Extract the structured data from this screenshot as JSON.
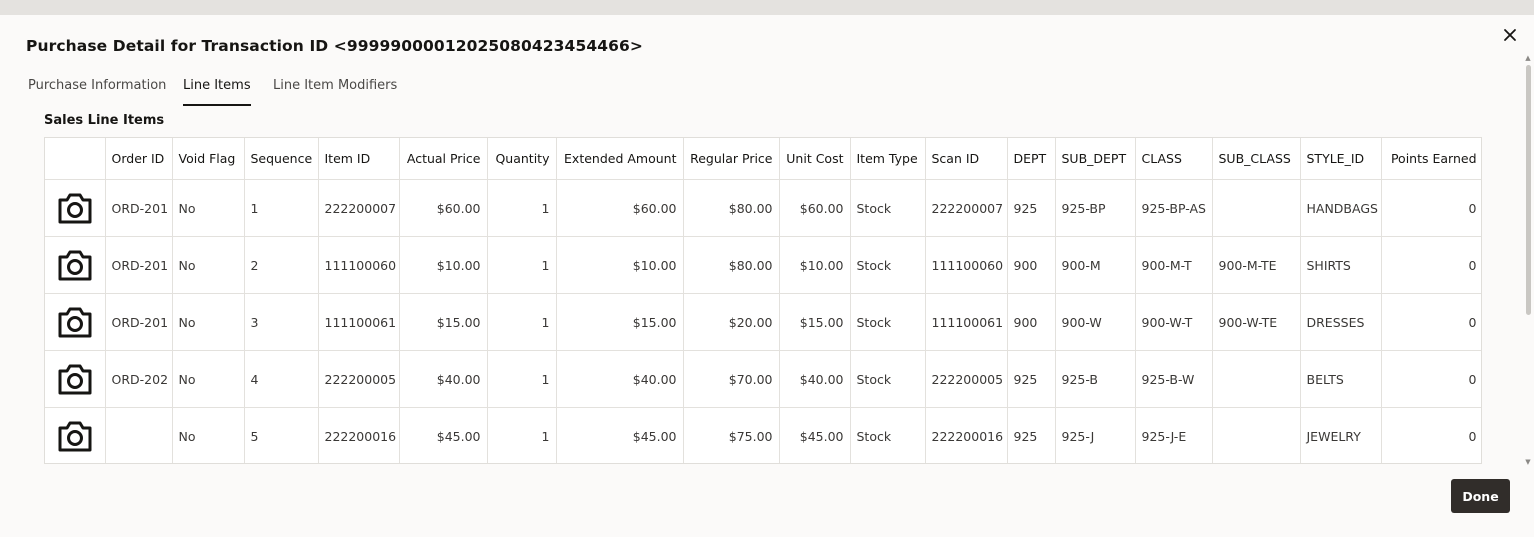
{
  "dialog": {
    "title": "Purchase Detail for Transaction ID <99999000012025080423454466>",
    "close_icon": "close-icon",
    "done_label": "Done"
  },
  "tabs": [
    {
      "label": "Purchase Information",
      "active": false
    },
    {
      "label": "Line Items",
      "active": true
    },
    {
      "label": "Line Item Modifiers",
      "active": false
    }
  ],
  "section_title": "Sales Line Items",
  "table": {
    "columns": [
      "",
      "Order ID",
      "Void Flag",
      "Sequence",
      "Item ID",
      "Actual Price",
      "Quantity",
      "Extended Amount",
      "Regular Price",
      "Unit Cost",
      "Item Type",
      "Scan ID",
      "DEPT",
      "SUB_DEPT",
      "CLASS",
      "SUB_CLASS",
      "STYLE_ID",
      "Points Earned"
    ],
    "rows": [
      {
        "image_icon": "camera-icon",
        "order_id": "ORD-201",
        "void_flag": "No",
        "sequence": "1",
        "item_id": "222200007",
        "actual_price": "$60.00",
        "quantity": "1",
        "extended_amount": "$60.00",
        "regular_price": "$80.00",
        "unit_cost": "$60.00",
        "item_type": "Stock",
        "scan_id": "222200007",
        "dept": "925",
        "sub_dept": "925-BP",
        "class": "925-BP-AS",
        "sub_class": "",
        "style_id": "HANDBAGS",
        "points_earned": "0"
      },
      {
        "image_icon": "camera-icon",
        "order_id": "ORD-201",
        "void_flag": "No",
        "sequence": "2",
        "item_id": "111100060",
        "actual_price": "$10.00",
        "quantity": "1",
        "extended_amount": "$10.00",
        "regular_price": "$80.00",
        "unit_cost": "$10.00",
        "item_type": "Stock",
        "scan_id": "111100060",
        "dept": "900",
        "sub_dept": "900-M",
        "class": "900-M-T",
        "sub_class": "900-M-TE",
        "style_id": "SHIRTS",
        "points_earned": "0"
      },
      {
        "image_icon": "camera-icon",
        "order_id": "ORD-201",
        "void_flag": "No",
        "sequence": "3",
        "item_id": "111100061",
        "actual_price": "$15.00",
        "quantity": "1",
        "extended_amount": "$15.00",
        "regular_price": "$20.00",
        "unit_cost": "$15.00",
        "item_type": "Stock",
        "scan_id": "111100061",
        "dept": "900",
        "sub_dept": "900-W",
        "class": "900-W-T",
        "sub_class": "900-W-TE",
        "style_id": "DRESSES",
        "points_earned": "0"
      },
      {
        "image_icon": "camera-icon",
        "order_id": "ORD-202",
        "void_flag": "No",
        "sequence": "4",
        "item_id": "222200005",
        "actual_price": "$40.00",
        "quantity": "1",
        "extended_amount": "$40.00",
        "regular_price": "$70.00",
        "unit_cost": "$40.00",
        "item_type": "Stock",
        "scan_id": "222200005",
        "dept": "925",
        "sub_dept": "925-B",
        "class": "925-B-W",
        "sub_class": "",
        "style_id": "BELTS",
        "points_earned": "0"
      },
      {
        "image_icon": "camera-icon",
        "order_id": "",
        "void_flag": "No",
        "sequence": "5",
        "item_id": "222200016",
        "actual_price": "$45.00",
        "quantity": "1",
        "extended_amount": "$45.00",
        "regular_price": "$75.00",
        "unit_cost": "$45.00",
        "item_type": "Stock",
        "scan_id": "222200016",
        "dept": "925",
        "sub_dept": "925-J",
        "class": "925-J-E",
        "sub_class": "",
        "style_id": "JEWELRY",
        "points_earned": "0"
      }
    ]
  },
  "colors": {
    "primary_button": "#312d2a",
    "active_tab_underline": "#161513"
  }
}
